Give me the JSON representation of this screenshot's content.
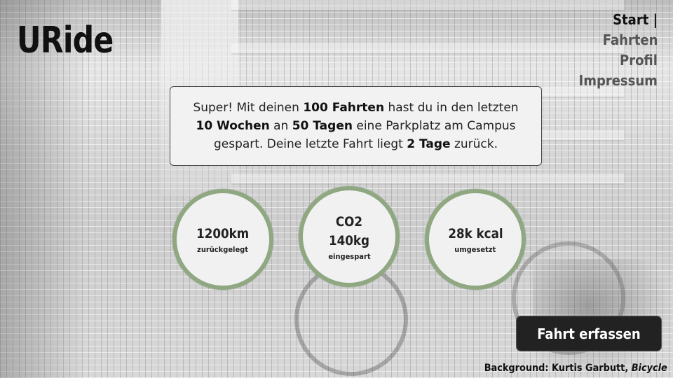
{
  "app": {
    "logo": "URide"
  },
  "nav": {
    "items": [
      {
        "label": "Start |",
        "active": true
      },
      {
        "label": "Fahrten",
        "active": false
      },
      {
        "label": "Profil",
        "active": false
      },
      {
        "label": "Impressum",
        "active": false
      }
    ]
  },
  "message": {
    "t1": "Super! Mit deinen ",
    "rides": "100 Fahrten",
    "t2": " hast du in den letzten ",
    "weeks": "10 Wochen",
    "t3": " an ",
    "days": "50 Tagen",
    "t4": " eine Parkplatz am Campus gespart. Deine letzte Fahrt liegt ",
    "last": "2 Tage",
    "t5": " zurück."
  },
  "stats": {
    "distance": {
      "value": "1200km",
      "label": "zurückgelegt"
    },
    "co2": {
      "value": "CO2\n140kg",
      "label": "eingespart"
    },
    "kcal": {
      "value": "28k kcal",
      "label": "umgesetzt"
    }
  },
  "cta": {
    "label": "Fahrt erfassen"
  },
  "credit": {
    "prefix": "Background: Kurtis Garbutt, ",
    "work": "Bicycle"
  },
  "colors": {
    "accent_ring": "#8fa882",
    "button_bg": "#222222"
  }
}
